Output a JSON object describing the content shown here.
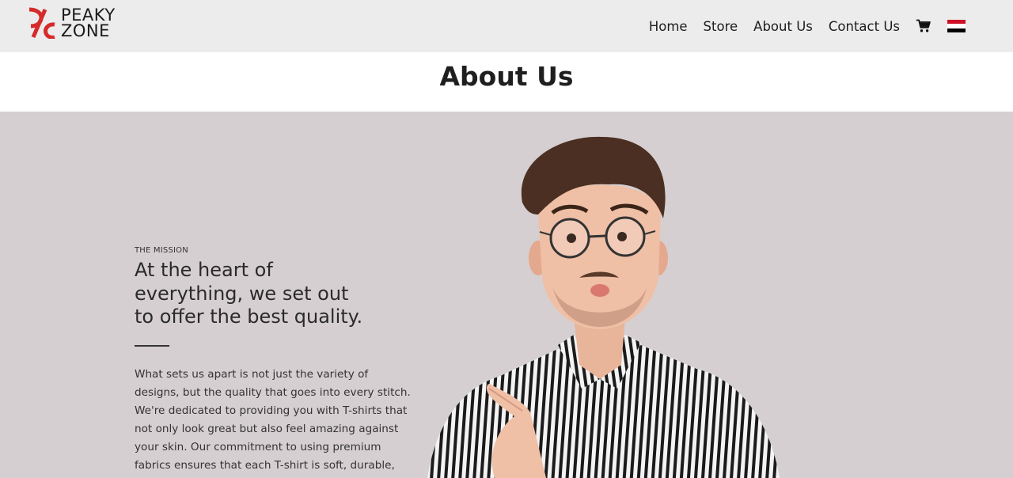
{
  "brand": {
    "name_line1": "PEAKY",
    "name_line2": "ZONE",
    "accent_color": "#d62b2b",
    "logo_icon": "peaky-zone-logo-mark"
  },
  "nav": {
    "links": [
      "Home",
      "Store",
      "About Us",
      "Contact Us"
    ],
    "cart_icon": "cart-icon",
    "language_flag": "egypt-flag-icon",
    "flag_colors": [
      "#ce1126",
      "#ffffff",
      "#000000"
    ]
  },
  "page": {
    "title": "About Us"
  },
  "mission": {
    "eyebrow": "THE MISSION",
    "headline": "At the heart of everything, we set out to offer the best quality.",
    "body": "What sets us apart is not just the variety of designs, but the quality that goes into every stitch. We're dedicated to providing you with T-shirts that not only look great but also feel amazing against your skin. Our commitment to using premium fabrics ensures that each T-shirt is soft, durable,",
    "background_color": "#d6cfd1"
  },
  "hero_image": {
    "subject": "man-in-glasses-pointing-photo"
  }
}
